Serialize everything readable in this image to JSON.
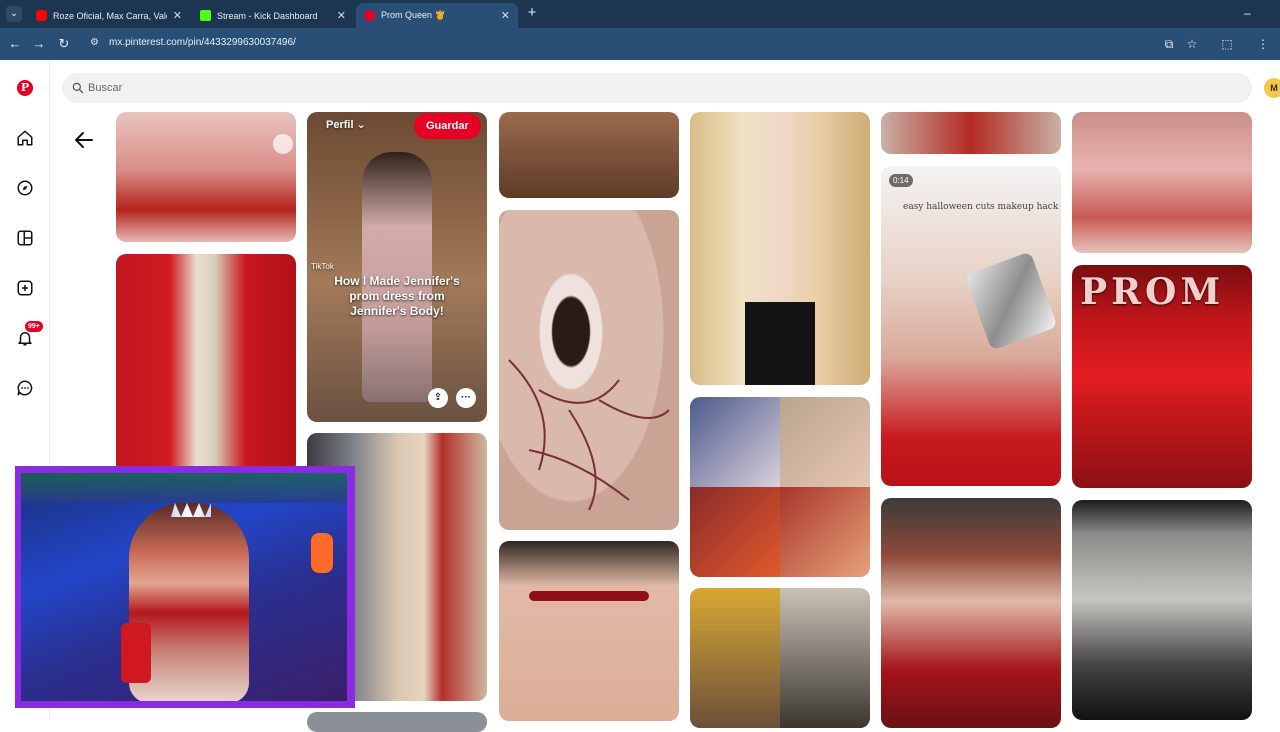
{
  "browser": {
    "tabs": [
      {
        "title": "Roze Oficial, Max Carra, Valen, C",
        "favicon_color": "#ff0000",
        "active": false
      },
      {
        "title": "Stream - Kick Dashboard",
        "favicon_color": "#53fc18",
        "active": false
      },
      {
        "title": "Prom Queen 👸",
        "favicon_color": "#e60023",
        "active": true
      }
    ],
    "url": "mx.pinterest.com/pin/4433299630037496/"
  },
  "pinterest": {
    "search_placeholder": "Buscar",
    "avatar_initial": "M",
    "notifications_badge": "99+",
    "accent_color": "#e60023",
    "rail_icons": [
      "pinterest-logo-icon",
      "home-icon",
      "explore-icon",
      "boards-icon",
      "create-icon",
      "bell-icon",
      "messages-icon"
    ]
  },
  "pins": {
    "featured": {
      "profile_label": "Perfil",
      "save_label": "Guardar",
      "overlay_text": "How I Made Jennifer's prom dress from Jennifer's Body!",
      "watermark": "TikTok"
    },
    "video": {
      "duration": "0:14",
      "caption": "easy halloween cuts makeup hack"
    },
    "prom_sign_text": "PROM"
  }
}
